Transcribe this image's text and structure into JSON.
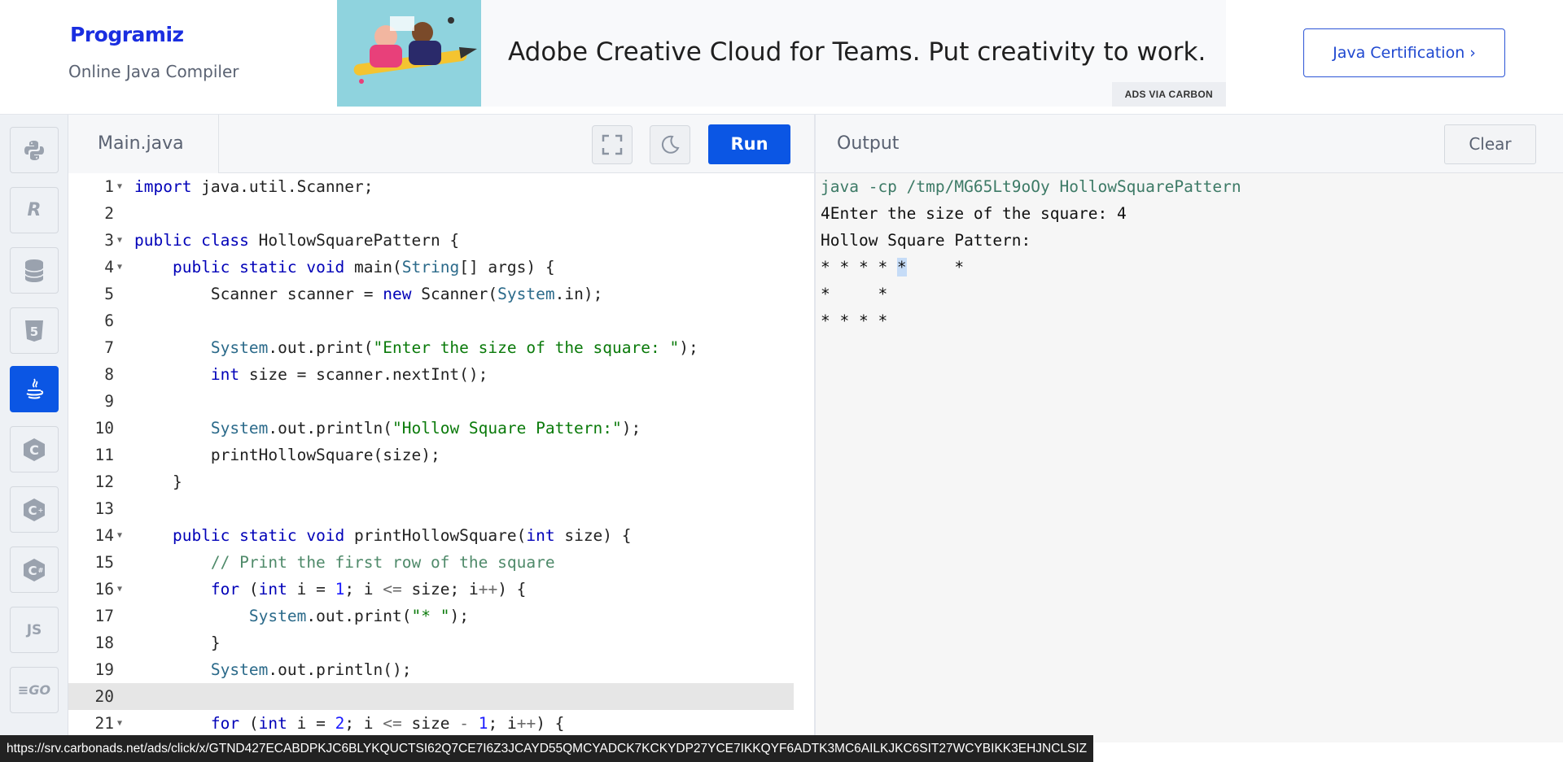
{
  "header": {
    "logo": "Programiz",
    "subtitle": "Online Java Compiler",
    "ad_text": "Adobe Creative Cloud for Teams. Put creativity to work.",
    "ad_via": "ADS VIA CARBON",
    "cert_button": "Java Certification ›"
  },
  "sidebar": {
    "languages": [
      {
        "name": "python-icon",
        "glyph": "🐍"
      },
      {
        "name": "r-icon",
        "glyph": "R"
      },
      {
        "name": "sql-icon",
        "glyph": "≋"
      },
      {
        "name": "html5-icon",
        "glyph": "5"
      },
      {
        "name": "java-icon",
        "glyph": "☕",
        "active": true
      },
      {
        "name": "c-icon",
        "glyph": "C"
      },
      {
        "name": "cpp-icon",
        "glyph": "C+"
      },
      {
        "name": "csharp-icon",
        "glyph": "C#"
      },
      {
        "name": "js-icon",
        "glyph": "JS"
      },
      {
        "name": "go-icon",
        "glyph": "GO"
      }
    ]
  },
  "editor": {
    "file_name": "Main.java",
    "run_label": "Run",
    "lines": [
      {
        "n": "1",
        "fold": true,
        "html": "<span class=\"kw\">import</span> java.util.Scanner;"
      },
      {
        "n": "2",
        "html": ""
      },
      {
        "n": "3",
        "fold": true,
        "html": "<span class=\"kw\">public class</span> HollowSquarePattern {"
      },
      {
        "n": "4",
        "fold": true,
        "html": "    <span class=\"kw\">public static void</span> main(<span class=\"cls\">String</span>[] args) {"
      },
      {
        "n": "5",
        "html": "        Scanner scanner = <span class=\"kw\">new</span> Scanner(<span class=\"cls\">System</span>.in);"
      },
      {
        "n": "6",
        "html": ""
      },
      {
        "n": "7",
        "html": "        <span class=\"cls\">System</span>.out.print(<span class=\"str\">\"Enter the size of the square: \"</span>);"
      },
      {
        "n": "8",
        "html": "        <span class=\"kw\">int</span> size = scanner.nextInt();"
      },
      {
        "n": "9",
        "html": ""
      },
      {
        "n": "10",
        "html": "        <span class=\"cls\">System</span>.out.println(<span class=\"str\">\"Hollow Square Pattern:\"</span>);"
      },
      {
        "n": "11",
        "html": "        printHollowSquare(size);"
      },
      {
        "n": "12",
        "html": "    }"
      },
      {
        "n": "13",
        "html": ""
      },
      {
        "n": "14",
        "fold": true,
        "html": "    <span class=\"kw\">public static void</span> printHollowSquare(<span class=\"kw\">int</span> size) {"
      },
      {
        "n": "15",
        "html": "        <span class=\"com\">// Print the first row of the square</span>"
      },
      {
        "n": "16",
        "fold": true,
        "html": "        <span class=\"kw\">for</span> (<span class=\"kw\">int</span> i = <span class=\"num\">1</span>; i <span class=\"op\">&lt;=</span> size; i<span class=\"op\">++</span>) {"
      },
      {
        "n": "17",
        "html": "            <span class=\"cls\">System</span>.out.print(<span class=\"str\">\"* \"</span>);"
      },
      {
        "n": "18",
        "html": "        }"
      },
      {
        "n": "19",
        "html": "        <span class=\"cls\">System</span>.out.println();"
      },
      {
        "n": "20",
        "highlight": true,
        "html": ""
      },
      {
        "n": "21",
        "fold": true,
        "html": "        <span class=\"kw\">for</span> (<span class=\"kw\">int</span> i = <span class=\"num\">2</span>; i <span class=\"op\">&lt;=</span> size <span class=\"op\">-</span> <span class=\"num\">1</span>; i<span class=\"op\">++</span>) {"
      }
    ]
  },
  "output": {
    "title": "Output",
    "clear_label": "Clear",
    "command": "java -cp /tmp/MG65Lt9oOy HollowSquarePattern",
    "lines": [
      "4Enter the size of the square: 4",
      "Hollow Square Pattern:",
      "* * * * ",
      "*     *",
      "* * * *"
    ],
    "line1_selected_char": "*",
    "line1_tail": "     *"
  },
  "status_url": "https://srv.carbonads.net/ads/click/x/GTND427ECABDPKJC6BLYKQUCTSI62Q7CE7I6Z3JCAYD55QMCYADCK7KCKYDP27YCE7IKKQYF6ADTK3MC6AILKJKC6SIT27WCYBIKK3EHJNCLSIZ"
}
